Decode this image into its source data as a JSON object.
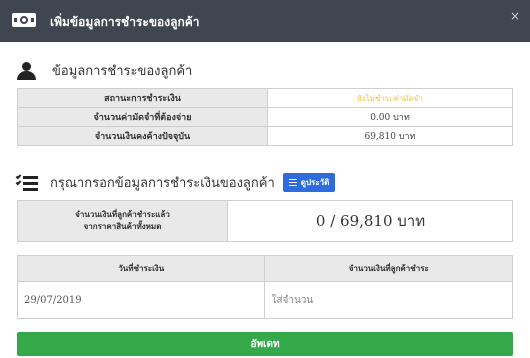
{
  "header": {
    "title": "เพิ่มข้อมูลการชำระของลูกค้า",
    "close": "×"
  },
  "customer_section": {
    "title": "ข้อมูลการชำระของลูกค้า"
  },
  "info_rows": [
    {
      "label": "สถานะการชำระเงิน",
      "value": "ยังไม่ชำระค่ามัดจำ"
    },
    {
      "label": "จำนวนค่ามัดจำที่ต้องจ่าย",
      "value": "0.00 บาท"
    },
    {
      "label": "จำนวนเงินคงค้างปัจจุบัน",
      "value": "69,810 บาท"
    }
  ],
  "entry_section": {
    "title": "กรุณากรอกข้อมูลการชำระเงินของลูกค้า",
    "history_label": "ดูประวัติ"
  },
  "summary": {
    "label_line1": "จำนวนเงินที่ลูกค้าชำระแล้ว",
    "label_line2": "จากราคาสินค้าทั้งหมด",
    "value": "0 / 69,810 บาท"
  },
  "payment_table": {
    "date_header": "วันที่ชำระเงิน",
    "amount_header": "จำนวนเงินที่ลูกค้าชำระ",
    "date_value": "29/07/2019",
    "amount_placeholder": "ใส่จำนวน"
  },
  "update_button": {
    "label": "อัพเดท"
  },
  "colors": {
    "header_bg": "#3f4650",
    "status_pending": "#f0c24b",
    "badge_blue": "#2d6cdf",
    "update_green": "#35a94a"
  }
}
